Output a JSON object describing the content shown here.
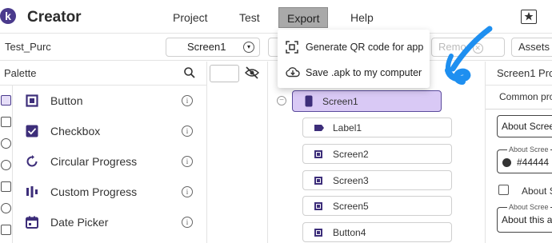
{
  "app": {
    "title": "Creator",
    "logo_letter": "k"
  },
  "menu": {
    "project": "Project",
    "test": "Test",
    "export": "Export",
    "help": "Help"
  },
  "toolbar": {
    "project_name": "Test_Purc",
    "screen_select": "Screen1",
    "remove_label": "Remo",
    "assets_label": "Assets"
  },
  "palette": {
    "title": "Palette",
    "items": [
      {
        "label": "Button",
        "icon": "button-icon"
      },
      {
        "label": "Checkbox",
        "icon": "checkbox-icon"
      },
      {
        "label": "Circular Progress",
        "icon": "circular-progress-icon"
      },
      {
        "label": "Custom Progress",
        "icon": "custom-progress-icon"
      },
      {
        "label": "Date Picker",
        "icon": "calendar-icon"
      }
    ]
  },
  "export_menu": {
    "items": [
      {
        "label": "Generate QR code for app",
        "icon": "qr-code-icon"
      },
      {
        "label": "Save .apk to my computer",
        "icon": "cloud-download-icon"
      }
    ]
  },
  "tree": {
    "root": "Screen1",
    "children": [
      "Label1",
      "Screen2",
      "Screen3",
      "Screen5",
      "Button4"
    ]
  },
  "properties": {
    "title": "Screen1 Pro",
    "tab": "Common pro",
    "about_screen_value": "About Scree",
    "bg_legend": "About Scree",
    "bg_value": "#44444",
    "checkbox_label": "About S",
    "about_legend": "About Scree",
    "about_value": "About this a"
  },
  "colors": {
    "accent": "#4a3a8c",
    "selected_bg": "#d9c9f5",
    "annotation": "#1e8ff0",
    "menu_active_bg": "#a9a9a9"
  }
}
